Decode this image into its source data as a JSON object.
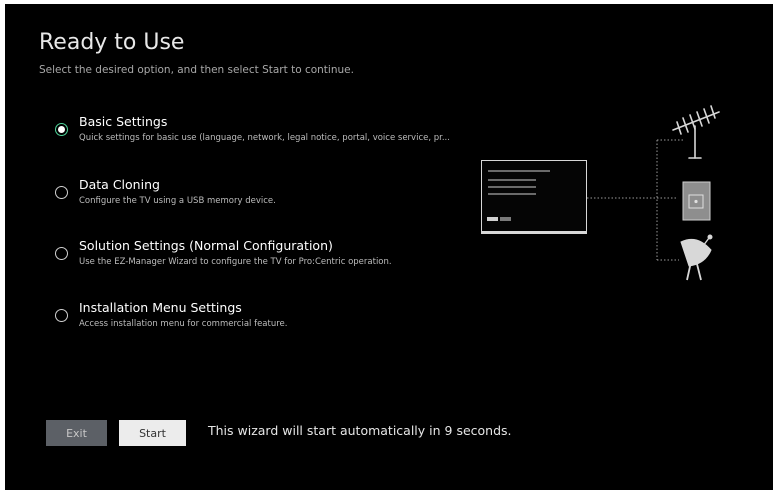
{
  "page": {
    "title": "Ready to Use",
    "subtitle": "Select the desired option, and then select Start to continue."
  },
  "options": [
    {
      "title": "Basic Settings",
      "description": "Quick settings for basic use (language, network, legal notice, portal, voice service, pr...",
      "selected": true
    },
    {
      "title": "Data Cloning",
      "description": "Configure the TV using a USB memory device.",
      "selected": false
    },
    {
      "title": "Solution Settings (Normal Configuration)",
      "description": "Use the EZ-Manager Wizard to configure the TV for Pro:Centric operation.",
      "selected": false
    },
    {
      "title": "Installation Menu Settings",
      "description": "Access installation menu for commercial feature.",
      "selected": false
    }
  ],
  "footer": {
    "exit_label": "Exit",
    "start_label": "Start",
    "countdown_text": "This wizard will start automatically in 9 seconds."
  },
  "colors": {
    "background": "#000000",
    "selected_radio": "#4fd49a",
    "exit_button": "#5c6066",
    "start_button": "#ececec"
  },
  "illustration": {
    "icons": [
      "tv-icon",
      "antenna-icon",
      "set-top-box-icon",
      "satellite-dish-icon"
    ]
  }
}
